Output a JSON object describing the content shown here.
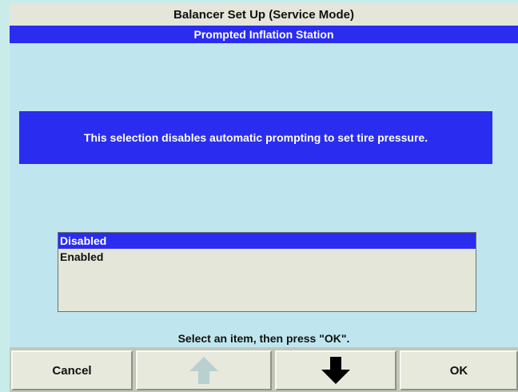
{
  "window": {
    "title": "Balancer Set Up (Service Mode)",
    "subtitle": "Prompted Inflation Station"
  },
  "message": "This selection disables automatic prompting to set tire pressure.",
  "list": {
    "items": [
      {
        "label": "Disabled",
        "selected": true
      },
      {
        "label": "Enabled",
        "selected": false
      }
    ]
  },
  "instruction": "Select an item, then press \"OK\".",
  "buttons": {
    "cancel_label": "Cancel",
    "up_icon": "arrow-up-icon",
    "up_enabled": false,
    "down_icon": "arrow-down-icon",
    "down_enabled": true,
    "ok_label": "OK"
  },
  "colors": {
    "accent_blue": "#2a2df0",
    "background": "#bfe6ee",
    "button_face": "#e6e9dc",
    "disabled_arrow": "#b9cfd0"
  }
}
